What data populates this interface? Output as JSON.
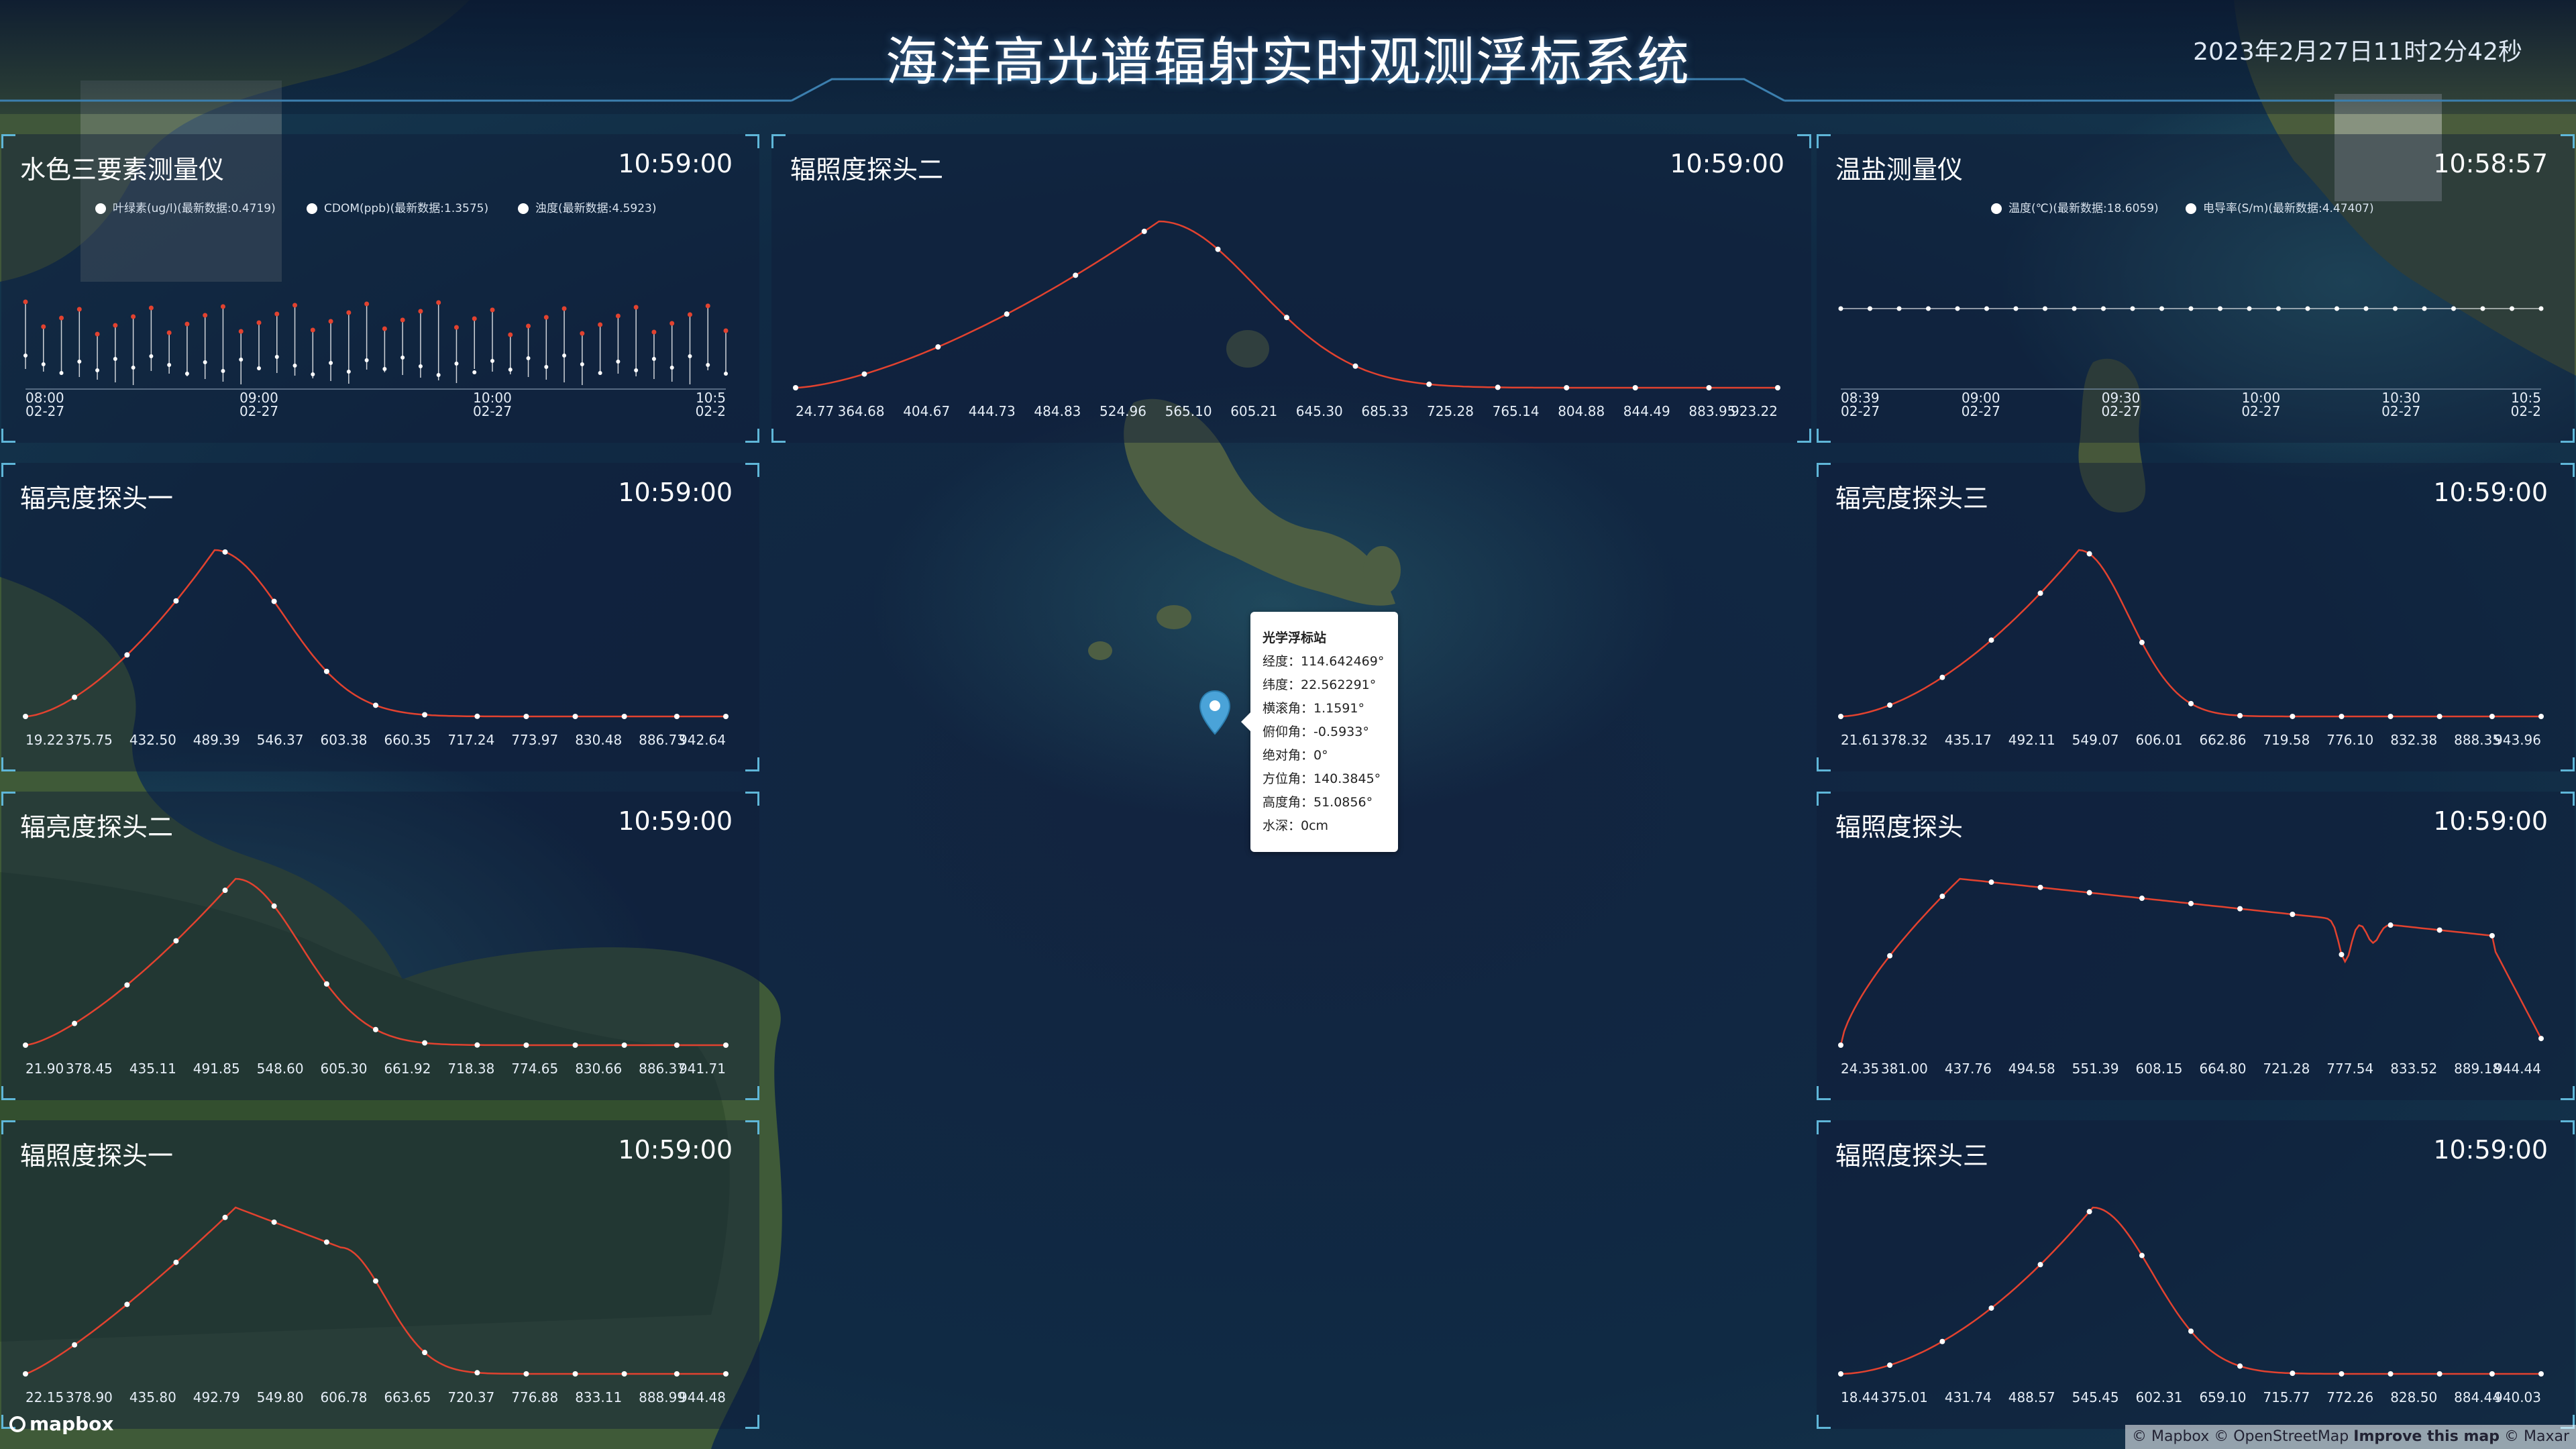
{
  "header": {
    "title": "海洋高光谱辐射实时观测浮标系统",
    "datetime": "2023年2月27日11时2分42秒"
  },
  "colors": {
    "accent": "#5fb6d8",
    "series_red": "#e2422f",
    "series_white": "#ffffff",
    "panel_bg": "rgba(16,30,56,0.48)"
  },
  "panels": [
    {
      "id": "water-color",
      "title": "水色三要素测量仪",
      "time": "10:59:00",
      "legend": [
        "叶绿素(ug/l)(最新数据:0.4719)",
        "CDOM(ppb)(最新数据:1.3575)",
        "浊度(最新数据:4.5923)"
      ],
      "x_labels": [
        "08:00\n02-27",
        "09:00\n02-27",
        "10:00\n02-27",
        "10:5\n02-2"
      ]
    },
    {
      "id": "irradiance-2",
      "title": "辐照度探头二",
      "time": "10:59:00",
      "x_labels": [
        "24.77",
        "364.68",
        "404.67",
        "444.73",
        "484.83",
        "524.96",
        "565.10",
        "605.21",
        "645.30",
        "685.33",
        "725.28",
        "765.14",
        "804.88",
        "844.49",
        "883.95",
        "923.22"
      ]
    },
    {
      "id": "temp-salinity",
      "title": "温盐测量仪",
      "time": "10:58:57",
      "legend": [
        "温度(℃)(最新数据:18.6059)",
        "电导率(S/m)(最新数据:4.47407)"
      ],
      "x_labels": [
        "08:39\n02-27",
        "09:00\n02-27",
        "09:30\n02-27",
        "10:00\n02-27",
        "10:30\n02-27",
        "10:5\n02-2"
      ]
    },
    {
      "id": "radiance-1",
      "title": "辐亮度探头一",
      "time": "10:59:00",
      "x_labels": [
        "19.22",
        "375.75",
        "432.50",
        "489.39",
        "546.37",
        "603.38",
        "660.35",
        "717.24",
        "773.97",
        "830.48",
        "886.73",
        "942.64"
      ]
    },
    {
      "id": "radiance-3",
      "title": "辐亮度探头三",
      "time": "10:59:00",
      "x_labels": [
        "21.61",
        "378.32",
        "435.17",
        "492.11",
        "549.07",
        "606.01",
        "662.86",
        "719.58",
        "776.10",
        "832.38",
        "888.35",
        "943.96"
      ]
    },
    {
      "id": "radiance-2",
      "title": "辐亮度探头二",
      "time": "10:59:00",
      "x_labels": [
        "21.90",
        "378.45",
        "435.11",
        "491.85",
        "548.60",
        "605.30",
        "661.92",
        "718.38",
        "774.65",
        "830.66",
        "886.37",
        "941.71"
      ]
    },
    {
      "id": "irradiance",
      "title": "辐照度探头",
      "time": "10:59:00",
      "x_labels": [
        "24.35",
        "381.00",
        "437.76",
        "494.58",
        "551.39",
        "608.15",
        "664.80",
        "721.28",
        "777.54",
        "833.52",
        "889.18",
        "944.44"
      ]
    },
    {
      "id": "irradiance-1",
      "title": "辐照度探头一",
      "time": "10:59:00",
      "x_labels": [
        "22.15",
        "378.90",
        "435.80",
        "492.79",
        "549.80",
        "606.78",
        "663.65",
        "720.37",
        "776.88",
        "833.11",
        "888.99",
        "944.48"
      ]
    },
    {
      "id": "irradiance-3",
      "title": "辐照度探头三",
      "time": "10:59:00",
      "x_labels": [
        "18.44",
        "375.01",
        "431.74",
        "488.57",
        "545.45",
        "602.31",
        "659.10",
        "715.77",
        "772.26",
        "828.50",
        "884.44",
        "940.03"
      ]
    }
  ],
  "popup": {
    "title": "光学浮标站",
    "lines": [
      "经度：114.642469°",
      "纬度：22.562291°",
      "横滚角：1.1591°",
      "俯仰角：-0.5933°",
      "绝对角：0°",
      "方位角：140.3845°",
      "高度角：51.0856°",
      "水深：0cm"
    ]
  },
  "attribution": {
    "logo": "mapbox",
    "text_prefix": "© Mapbox © OpenStreetMap ",
    "improve": "Improve this map",
    "text_suffix": " © Maxar"
  }
}
